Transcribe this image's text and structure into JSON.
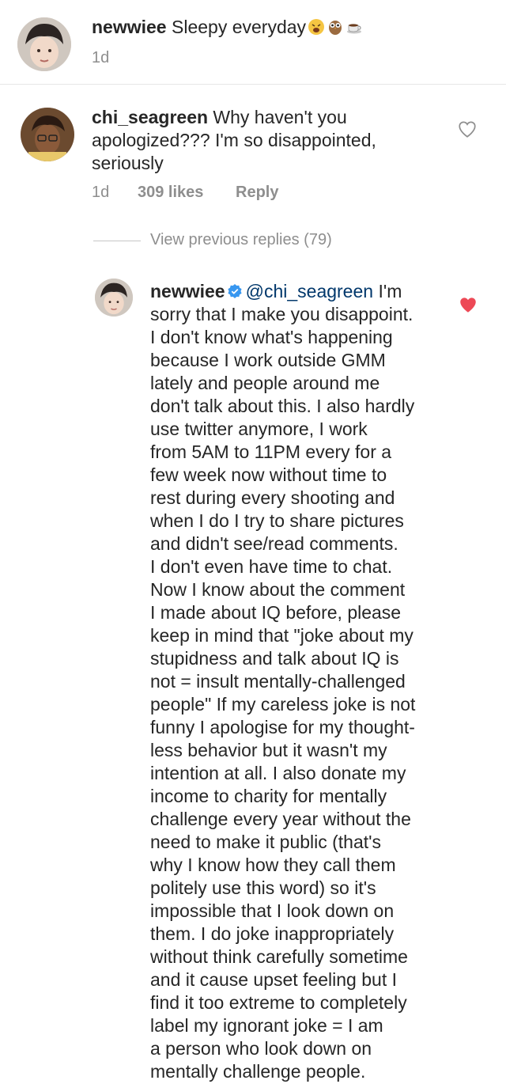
{
  "comment1": {
    "username": "newwiee",
    "text": "Sleepy everyday",
    "time": "1d",
    "emoji_icons": [
      "tired-face-icon",
      "owl-icon",
      "coffee-icon"
    ]
  },
  "comment2": {
    "username": "chi_seagreen",
    "text": "Why haven't you apologized??? I'm so disappointed, seriously",
    "time": "1d",
    "likes": "309 likes",
    "reply_label": "Reply"
  },
  "view_previous_replies": "View previous replies (79)",
  "reply": {
    "username": "newwiee",
    "mention": "@chi_seagreen",
    "first_line_rest": "I'm",
    "body": "sorry that I make you disappoint.\nI don't know what's happening\nbecause I work outside GMM\nlately and people around me\ndon't talk about this. I also hardly\nuse twitter anymore, I work\nfrom 5AM to 11PM every for a\nfew week now without time to\nrest during every shooting and\nwhen I do I try to share pictures\nand didn't see/read comments.\nI don't even have time to chat.\nNow I know about the comment\nI made about IQ before, please\nkeep in mind that \"joke about my\nstupidness and talk about IQ is\nnot = insult mentally-challenged\npeople\" If my careless joke is not\nfunny I apologise for my thought-\nless behavior but it wasn't my\nintention at all. I also donate my\nincome to charity for mentally\nchallenge every year without the\nneed to make it public (that's\nwhy I know how they call them\npolitely use this word) so it's\nimpossible that I look down on\nthem. I do joke inappropriately\nwithout think carefully sometime\nand it cause upset feeling but I\nfind it too extreme to completely\nlabel  my ignorant joke = I am\na person who look down on\nmentally challenge people.",
    "liked": true
  },
  "colors": {
    "text": "#262626",
    "meta": "#8e8e8e",
    "mention": "#00376b",
    "heart_liked": "#ed4956",
    "verified": "#3897f0",
    "divider": "#e6e6e6"
  }
}
